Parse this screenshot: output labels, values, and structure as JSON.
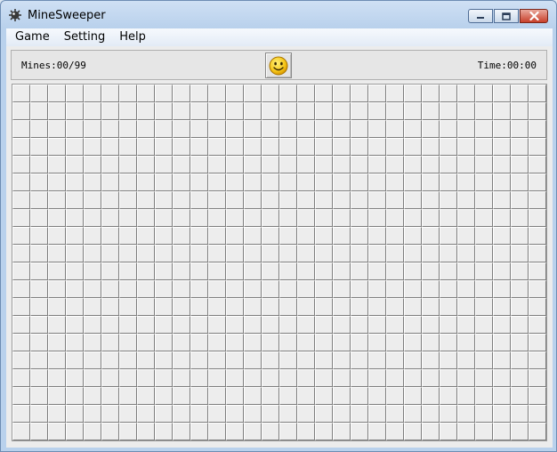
{
  "window": {
    "title": "MineSweeper",
    "icon": "mine-icon"
  },
  "menu": [
    {
      "label": "Game"
    },
    {
      "label": "Setting"
    },
    {
      "label": "Help"
    }
  ],
  "status": {
    "mines_text": "Mines:00/99",
    "time_text": "Time:00:00",
    "face_icon": "smiley-face-icon"
  },
  "board": {
    "rows": 20,
    "cols": 30,
    "state": "all-covered"
  },
  "colors": {
    "face_yellow": "#f5c518",
    "cell_face": "#ededed",
    "close_red": "#c8402b"
  }
}
